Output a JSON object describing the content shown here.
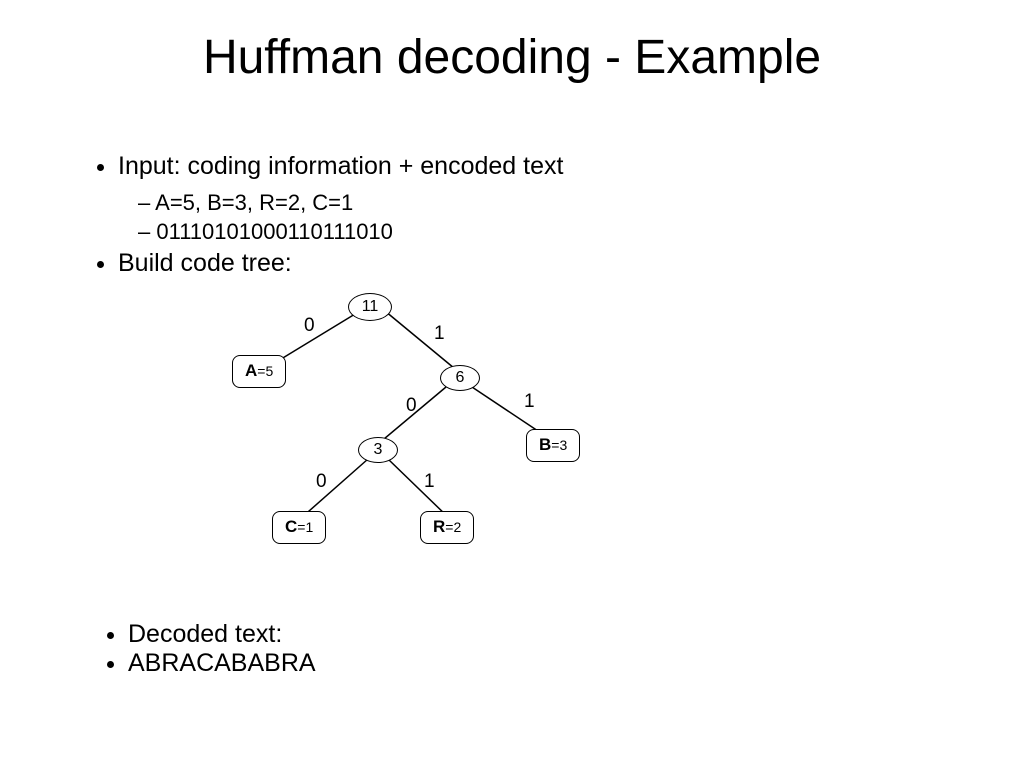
{
  "title": "Huffman decoding - Example",
  "bullets": {
    "input": "Input: coding information + encoded text",
    "freq": "A=5, B=3, R=2, C=1",
    "bits": "01110101000110111010",
    "build": "Build code tree:",
    "decoded_label": "Decoded text:",
    "decoded_value": "ABRACABABRA"
  },
  "tree": {
    "n11": "11",
    "n6": "6",
    "n3": "3",
    "A": {
      "sym": "A",
      "val": "=5"
    },
    "B": {
      "sym": "B",
      "val": "=3"
    },
    "C": {
      "sym": "C",
      "val": "=1"
    },
    "R": {
      "sym": "R",
      "val": "=2"
    },
    "e": {
      "l0": "0",
      "l1": "1"
    }
  }
}
